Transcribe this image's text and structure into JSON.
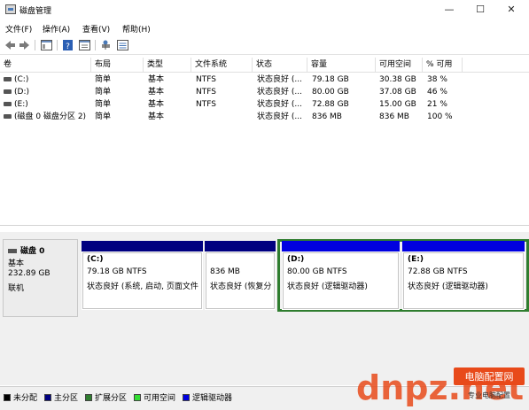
{
  "window": {
    "title": "磁盘管理",
    "min_glyph": "—",
    "max_glyph": "☐",
    "close_glyph": "✕"
  },
  "menu": [
    "文件(F)",
    "操作(A)",
    "查看(V)",
    "帮助(H)"
  ],
  "toolbar": [
    "back-arrow-icon",
    "forward-arrow-icon",
    "console-tree-icon",
    "help-icon",
    "properties-icon",
    "connect-disk-icon",
    "list-view-icon"
  ],
  "table": {
    "columns": [
      "卷",
      "布局",
      "类型",
      "文件系统",
      "状态",
      "容量",
      "可用空间",
      "% 可用"
    ],
    "rows": [
      [
        "(C:)",
        "简单",
        "基本",
        "NTFS",
        "状态良好 (...",
        "79.18 GB",
        "30.38 GB",
        "38 %"
      ],
      [
        "(D:)",
        "简单",
        "基本",
        "NTFS",
        "状态良好 (...",
        "80.00 GB",
        "37.08 GB",
        "46 %"
      ],
      [
        "(E:)",
        "简单",
        "基本",
        "NTFS",
        "状态良好 (...",
        "72.88 GB",
        "15.00 GB",
        "21 %"
      ],
      [
        "(磁盘 0 磁盘分区 2)",
        "简单",
        "基本",
        "",
        "状态良好 (...",
        "836 MB",
        "836 MB",
        "100 %"
      ]
    ]
  },
  "disk": {
    "name": "磁盘 0",
    "type": "基本",
    "size": "232.89 GB",
    "status": "联机"
  },
  "partitions": [
    {
      "name": "(C:)",
      "size": "79.18 GB NTFS",
      "status": "状态良好 (系统, 启动, 页面文件",
      "bar_color": "#000080"
    },
    {
      "name": "",
      "size": "836 MB",
      "status": "状态良好 (恢复分",
      "bar_color": "#000080"
    },
    {
      "name": "(D:)",
      "size": "80.00 GB NTFS",
      "status": "状态良好 (逻辑驱动器)",
      "bar_color": "#0000e0"
    },
    {
      "name": "(E:)",
      "size": "72.88 GB NTFS",
      "status": "状态良好 (逻辑驱动器)",
      "bar_color": "#0000e0"
    }
  ],
  "legend": [
    {
      "label": "未分配",
      "color": "#000000"
    },
    {
      "label": "主分区",
      "color": "#000080"
    },
    {
      "label": "扩展分区",
      "color": "#2f7d2f"
    },
    {
      "label": "可用空间",
      "color": "#33dd33"
    },
    {
      "label": "逻辑驱动器",
      "color": "#0000e0"
    }
  ],
  "watermark": {
    "logo_text": "dnpz.net",
    "badge_top": "电脑配置网",
    "badge_bottom": "专业电脑配置"
  }
}
